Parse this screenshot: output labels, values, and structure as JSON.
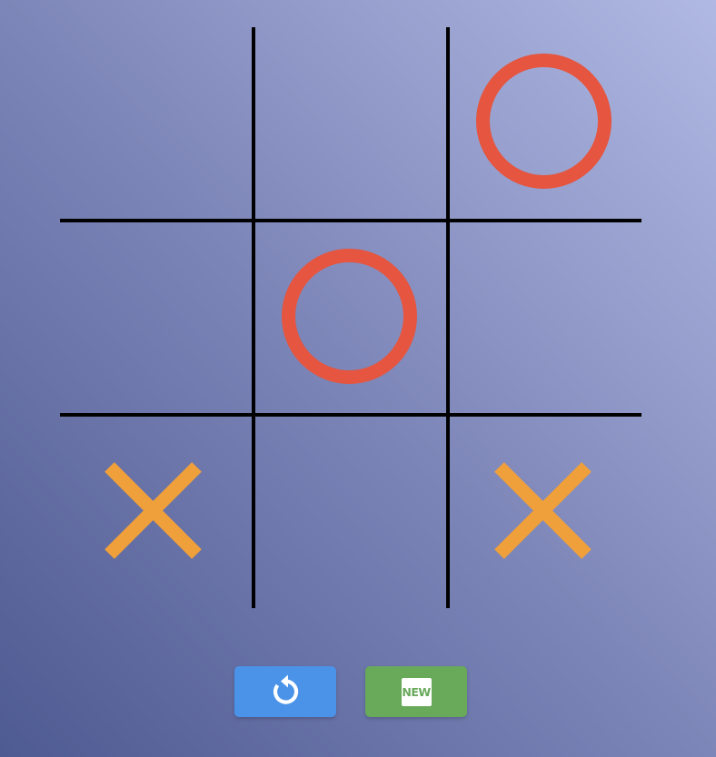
{
  "board": {
    "cells": [
      "",
      "",
      "O",
      "",
      "O",
      "",
      "X",
      "",
      "X"
    ]
  },
  "colors": {
    "x_mark": "#f0a03a",
    "o_mark": "#e5553f",
    "grid_line": "#000000",
    "restart_button": "#4b93e9",
    "new_game_button": "#68a95a"
  },
  "controls": {
    "restart_icon": "restart-icon",
    "new_badge_text": "NEW"
  }
}
